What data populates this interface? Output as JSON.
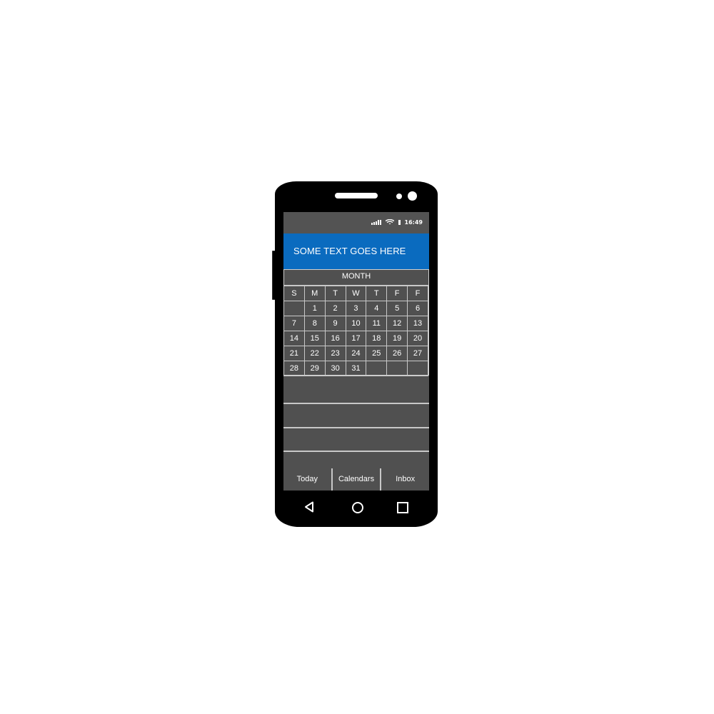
{
  "status_bar": {
    "time": "16:49",
    "icons": [
      "signal-icon",
      "wifi-icon",
      "battery-icon"
    ]
  },
  "app_bar": {
    "title": "SOME TEXT GOES HERE",
    "color": "#0a6bbf"
  },
  "calendar": {
    "month_label": "MONTH",
    "weekdays": [
      "S",
      "M",
      "T",
      "W",
      "T",
      "F",
      "F"
    ],
    "weeks": [
      [
        "",
        "1",
        "2",
        "3",
        "4",
        "5",
        "6"
      ],
      [
        "7",
        "8",
        "9",
        "10",
        "11",
        "12",
        "13"
      ],
      [
        "14",
        "15",
        "16",
        "17",
        "18",
        "19",
        "20"
      ],
      [
        "21",
        "22",
        "23",
        "24",
        "25",
        "26",
        "27"
      ],
      [
        "28",
        "29",
        "30",
        "31",
        "",
        "",
        ""
      ]
    ]
  },
  "tabs": [
    {
      "label": "Today"
    },
    {
      "label": "Calendars"
    },
    {
      "label": "Inbox"
    }
  ],
  "nav_bar": {
    "icons": [
      "back-icon",
      "home-icon",
      "recent-apps-icon"
    ]
  }
}
